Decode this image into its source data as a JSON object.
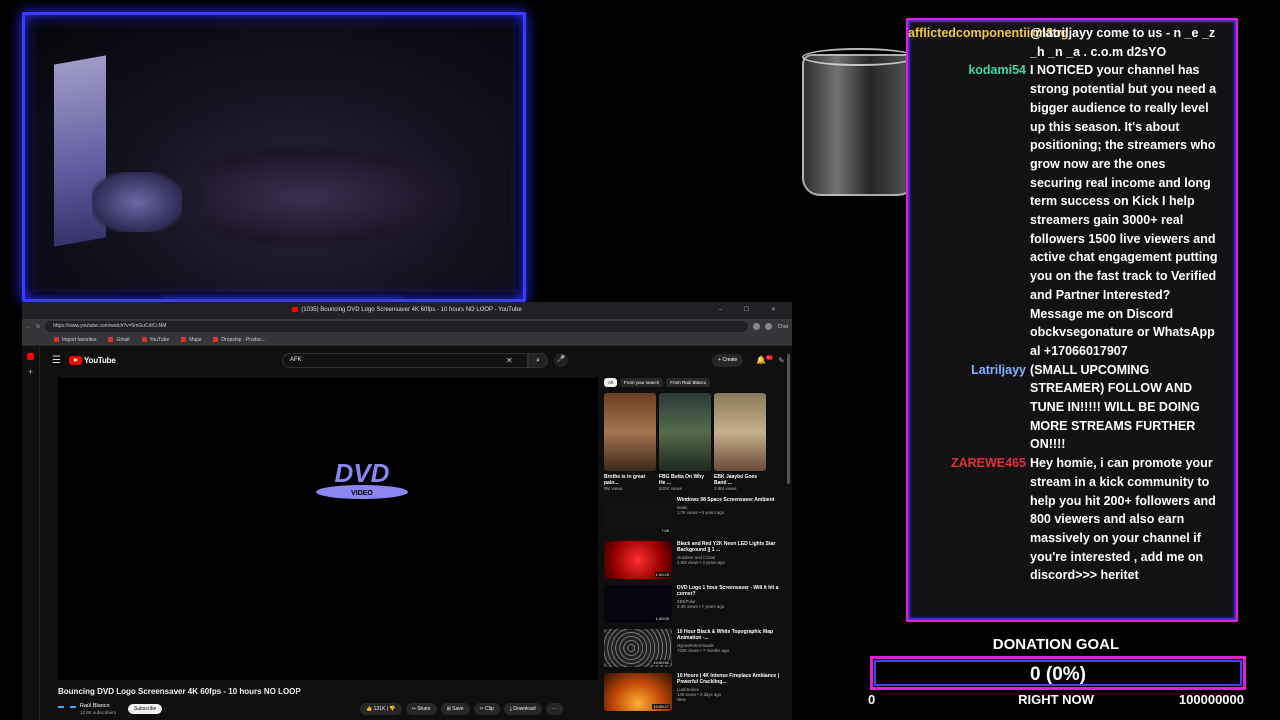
{
  "browser": {
    "window_title": "(1035) Bouncing DVD Logo Screensaver 4K 60fps - 10 hours NO LOOP - YouTube",
    "url": "https://www.youtube.com/watch?v=5mGuCdlCcNM",
    "bookmarks": [
      "Import favorites",
      "Gmail",
      "YouTube",
      "Maps",
      "Dropship - Produc..."
    ],
    "chat_btn": "Chat"
  },
  "youtube": {
    "logo_text": "YouTube",
    "search_value": "AFK",
    "create_label": "Create",
    "notif_count": "9+",
    "video": {
      "dvd_text": "DVD",
      "dvd_sub": "VIDEO",
      "title": "Bouncing DVD Logo Screensaver 4K 60fps - 10 hours NO LOOP",
      "channel": "Raúl Blanco",
      "subs": "12.8K subscribers",
      "subscribe": "Subscribe",
      "likes": "131K",
      "share": "Share",
      "save": "Save",
      "clip": "Clip",
      "download": "Download"
    },
    "chips": [
      "All",
      "From your search",
      "From Raúl Blanco"
    ],
    "shorts": [
      {
        "title": "Brothe is in great pain...",
        "views": "9M views",
        "color": "#8a5a3a"
      },
      {
        "title": "FBG Butta On Why He ...",
        "views": "522K views",
        "color": "#3a4a3a"
      },
      {
        "title": "EBK Jaaybo Goes Band ...",
        "views": "3.9M views",
        "color": "#9a8a6a"
      }
    ],
    "recommendations": [
      {
        "title": "Windows 98 Space Screensaver Ambient",
        "channel": "Moits",
        "meta": "1.7K views • 6 years ago",
        "duration": "7:58",
        "color": "#111"
      },
      {
        "title": "Black and Red Y2K Neon LED Lights Star Background || 1 ...",
        "channel": "Gradient and Colour",
        "meta": "2.8M views • 3 years ago",
        "duration": "1:00:25",
        "color": "#c0101a"
      },
      {
        "title": "DVD Logo 1 hour Screensaver - Will it hit a corner?",
        "channel": "EBKPoke",
        "meta": "8.3K views • 7 years ago",
        "duration": "1:00:00",
        "color": "#050510"
      },
      {
        "title": "10 Hour Black & White Topographic Map Animation -...",
        "channel": "HypnoRetroVisuals",
        "meta": "733K views • 7 months ago",
        "duration": "10:00:51",
        "color": "#222"
      },
      {
        "title": "10 Hours | 4K Intense Fireplace Ambiance | Powerful Crackling...",
        "channel": "LumiSolace",
        "meta": "145 views • 3 days ago",
        "duration": "10:00:17",
        "badge": "New",
        "color": "#b8480a"
      }
    ]
  },
  "chat": {
    "messages": [
      {
        "user": "afflictedcomponentiirm3og",
        "color": "#f5c542",
        "text": "@latriljayy come to us - n _e _z _h _n _a . c.o.m d2sYO"
      },
      {
        "user": "kodami54",
        "color": "#3bd6a5",
        "text": "I NOTICED your channel has strong potential but you need a bigger audience to really level up this season. It's about positioning; the streamers who grow now are the ones securing real income and long term success on Kick I help streamers gain 3000+ real followers 1500 live viewers and active chat engagement putting you on the fast track to Verified and Partner Interested? Message me on Discord obckvsegonature or WhatsApp al +17066017907"
      },
      {
        "user": "Latriljayy",
        "color": "#7fb3ff",
        "text": "(SMALL UPCOMING STREAMER) FOLLOW AND TUNE IN!!!!! WILL BE DOING MORE STREAMS FURTHER ON!!!!"
      },
      {
        "user": "ZAREWE465",
        "color": "#e0303a",
        "text": "Hey homie, i can promote your stream in a kick community to help you hit 200+ followers and 800 viewers and also earn massively on your channel if you're interested , add me on discord>>> heritet"
      }
    ]
  },
  "donation": {
    "title": "DONATION GOAL",
    "value_text": "0 (0%)",
    "progress_fraction": 0,
    "min": "0",
    "now_label": "RIGHT NOW",
    "max": "100000000"
  }
}
